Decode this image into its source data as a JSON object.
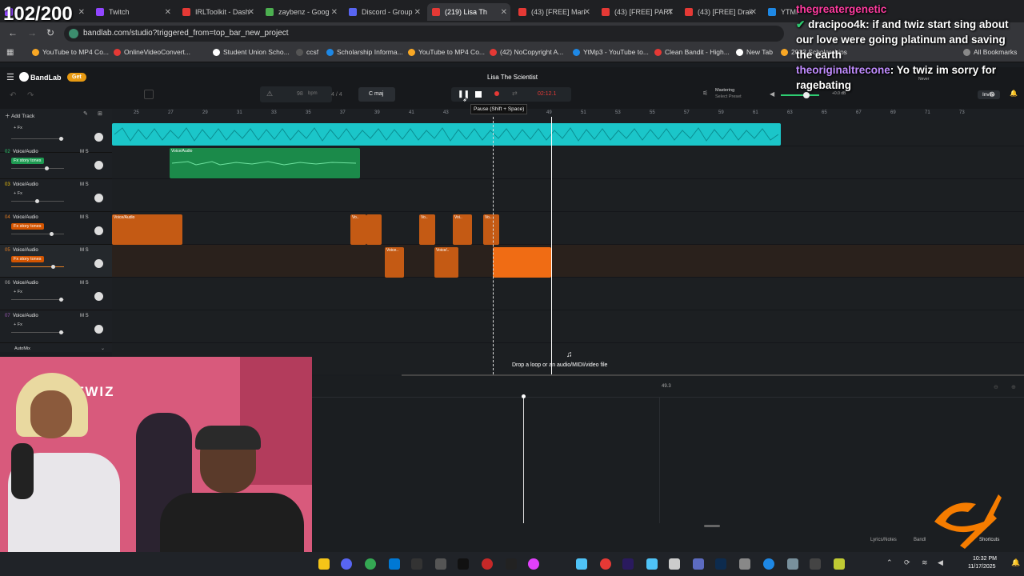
{
  "counter": "102/200",
  "tabs": [
    {
      "label": "",
      "color": "#9146ff"
    },
    {
      "label": "Twitch",
      "color": "#9146ff"
    },
    {
      "label": "IRLToolkit - Dash",
      "color": "#e53935"
    },
    {
      "label": "zaybenz - Goog",
      "color": "#4caf50"
    },
    {
      "label": "Discord - Group",
      "color": "#5865f2"
    },
    {
      "label": "(219) Lisa Th",
      "color": "#e53935"
    },
    {
      "label": "(43) [FREE] Mari",
      "color": "#e53935"
    },
    {
      "label": "(43) [FREE] PART",
      "color": "#e53935"
    },
    {
      "label": "(43) [FREE] Drak",
      "color": "#e53935"
    },
    {
      "label": "YTMP3",
      "color": "#1e88e5"
    }
  ],
  "url": "bandlab.com/studio?triggered_from=top_bar_new_project",
  "bookmarks": [
    "YouTube to MP4 Co...",
    "OnlineVideoConvert...",
    "Student Union Scho...",
    "ccsf",
    "Scholarship Informa...",
    "YouTube to MP4 Co...",
    "(42) NoCopyright A...",
    "YtMp3 - YouTube to...",
    "Clean Bandit - High...",
    "New Tab",
    "2023 Scholarships",
    "All Bookmarks"
  ],
  "bandlab": {
    "logo": "BandLab",
    "get_label": "Get",
    "project_title": "Lisa The Scientist",
    "bpm": "98",
    "bpm_unit": "bpm",
    "time_sig": "4 / 4",
    "key": "C maj",
    "time": "02:12.1",
    "tooltip": "Pause (Shift + Space)",
    "mastering": "Mastering",
    "select_preset": "Select Preset",
    "gain": "+0.0 dB",
    "never": "Never",
    "invite": "Invite",
    "add_track": "Add Track",
    "automix": "AutoMix",
    "drop_text": "Drop a loop or an audio/MIDI/video file",
    "bottom_marker": "49.3",
    "lyrics_notes": "Lyrics/Notes",
    "bandlab_footer": "Bandl",
    "shortcuts": "Shortcuts"
  },
  "ruler": [
    "25",
    "27",
    "29",
    "31",
    "33",
    "35",
    "37",
    "39",
    "41",
    "43",
    "45",
    "47",
    "49",
    "51",
    "53",
    "55",
    "57",
    "59",
    "61",
    "63",
    "65",
    "67",
    "69",
    "71",
    "73"
  ],
  "tracks": [
    {
      "num": "",
      "name": "",
      "fx": "+ Fx",
      "fx_color": "",
      "ms": "",
      "num_color": "#fff"
    },
    {
      "num": "02",
      "name": "Voice/Audio",
      "fx": "Fx story tones",
      "fx_color": "#1e9b52",
      "ms": "M  S",
      "num_color": "#2ecc71"
    },
    {
      "num": "03",
      "name": "Voice/Audio",
      "fx": "+ Fx",
      "fx_color": "",
      "ms": "M  S",
      "num_color": "#f1c40f"
    },
    {
      "num": "04",
      "name": "Voice/Audio",
      "fx": "Fx story tones",
      "fx_color": "#d35400",
      "ms": "M  S",
      "num_color": "#e67e22"
    },
    {
      "num": "05",
      "name": "Voice/Audio",
      "fx": "Fx story tones",
      "fx_color": "#d35400",
      "ms": "M  S",
      "num_color": "#e67e22"
    },
    {
      "num": "06",
      "name": "Voice/Audio",
      "fx": "+ Fx",
      "fx_color": "",
      "ms": "M  S",
      "num_color": "#aaa"
    },
    {
      "num": "07",
      "name": "Voice/Audio",
      "fx": "+ Fx",
      "fx_color": "",
      "ms": "M  S",
      "num_color": "#9b59b6"
    }
  ],
  "clip_labels": {
    "green": "Voice/Audio",
    "orange_a": "Voice/Audio",
    "orange_b": "Vo..",
    "orange_c": "Vo..",
    "orange_d": "Voi..",
    "orange_e": "Vo..",
    "orange_f": "Voice..",
    "orange_g": "Voice/.."
  },
  "webcam_text": "TWIZ",
  "chat": [
    {
      "user": "thegreatergenetic",
      "msg": "",
      "color": "#ff3ca0"
    },
    {
      "user": "dracipoo4k",
      "msg": "if      and twiz start sing about our love were going platinum and saving the earth",
      "color": "#ffffff"
    },
    {
      "user": "theoriginaltrecone",
      "msg": "Yo twiz       im sorry for ragebating",
      "color": "#c08cff"
    }
  ],
  "clock": {
    "time": "10:32 PM",
    "date": "11/17/2025"
  }
}
